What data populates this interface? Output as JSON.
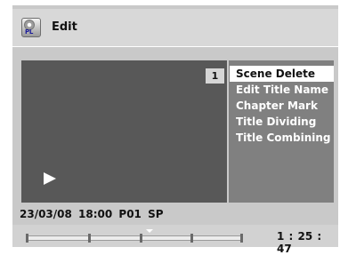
{
  "header": {
    "icon": "pl-disc-icon",
    "icon_label": "PL",
    "title": "Edit"
  },
  "video": {
    "title_number": "1",
    "play_icon": "play-icon"
  },
  "menu": {
    "items": [
      {
        "label": "Scene Delete",
        "selected": true
      },
      {
        "label": "Edit Title Name",
        "selected": false
      },
      {
        "label": "Chapter Mark",
        "selected": false
      },
      {
        "label": "Title Dividing",
        "selected": false
      },
      {
        "label": "Title Combining",
        "selected": false
      }
    ]
  },
  "status": {
    "info": "23/03/08  18:00  P01  SP"
  },
  "progress": {
    "chapter_marks": 5,
    "position_fraction": 0.52,
    "time": "1 : 25 : 47"
  },
  "colors": {
    "panel": "#c9c9c9",
    "video": "#585858",
    "menu": "#808080",
    "selection": "#ffffff"
  }
}
